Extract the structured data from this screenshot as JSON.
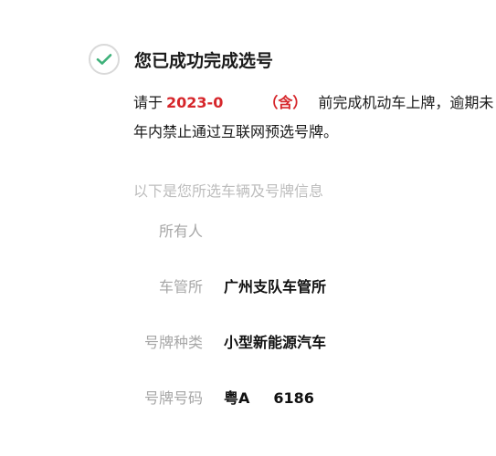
{
  "header": {
    "check_icon": "check-circle-icon",
    "check_color": "#3fb17a",
    "title": "您已成功完成选号"
  },
  "notice": {
    "prefix": "请于",
    "date": "2023-0",
    "inclusive": "（含）",
    "line1_rest": "前完成机动车上牌，逾期未",
    "line2": "年内禁止通过互联网预选号牌。",
    "accent_color": "#d6262b"
  },
  "info": {
    "section_title": "以下是您所选车辆及号牌信息",
    "rows": [
      {
        "label": "所有人",
        "value": ""
      },
      {
        "label": "车管所",
        "value": "广州支队车管所"
      },
      {
        "label": "号牌种类",
        "value": "小型新能源汽车"
      }
    ],
    "plate": {
      "label": "号牌号码",
      "prefix": "粤A",
      "number": "6186"
    }
  }
}
